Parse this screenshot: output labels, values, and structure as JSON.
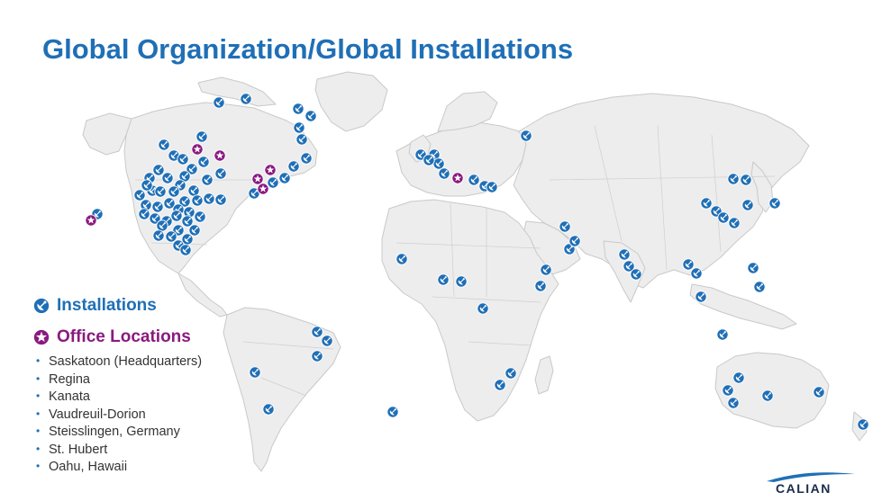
{
  "title": "Global Organization/Global Installations",
  "colors": {
    "title": "#1f6fb6",
    "installation": "#1f6fb6",
    "office": "#8a1a80",
    "land": "#ededed",
    "border": "#c9c9c9"
  },
  "legend": {
    "installations": {
      "label": "Installations",
      "icon": "satellite-dish-icon"
    },
    "offices": {
      "label": "Office Locations",
      "icon": "star-icon"
    }
  },
  "offices": [
    "Saskatoon (Headquarters)",
    "Regina",
    "Kanata",
    "Vaudreuil-Dorion",
    "Steisslingen, Germany",
    "St. Hubert",
    "Oahu, Hawaii"
  ],
  "logo": {
    "text": "CALIAN",
    "mark": "®"
  }
}
